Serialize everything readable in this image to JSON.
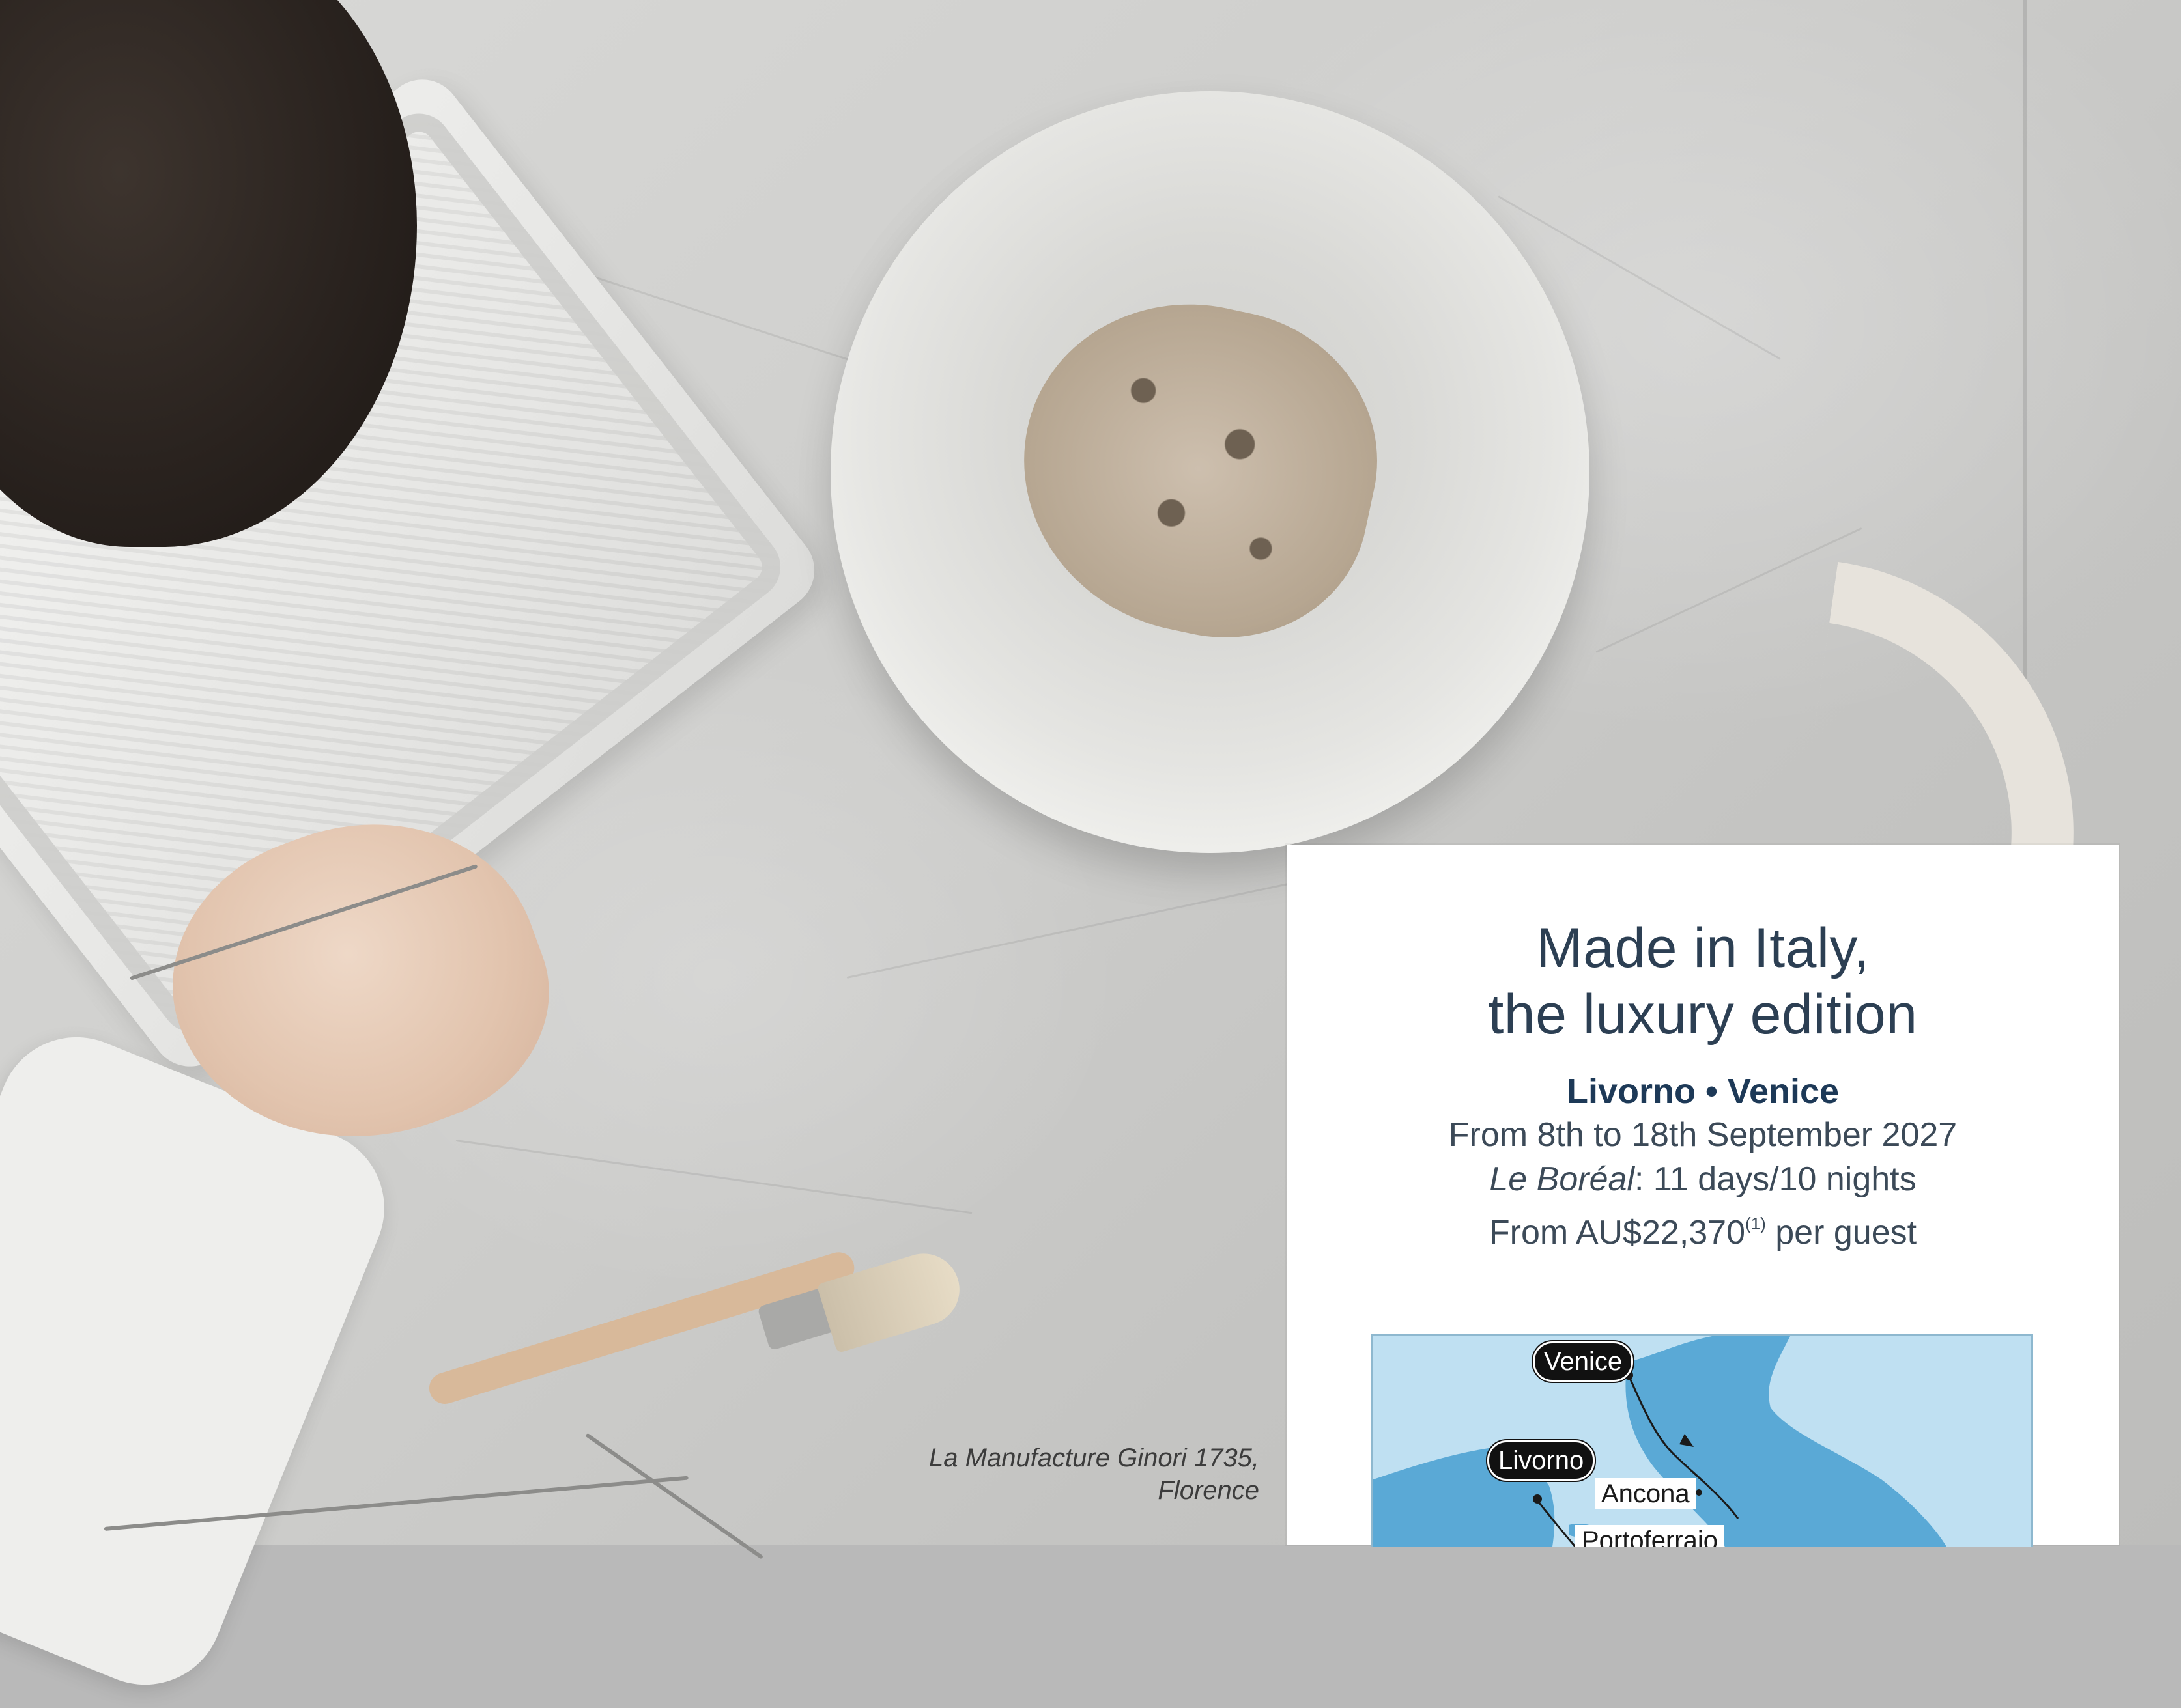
{
  "photo": {
    "caption_line1": "La Manufacture Ginori 1735,",
    "caption_line2": "Florence"
  },
  "card": {
    "title_line1": "Made in Italy,",
    "title_line2": "the luxury edition",
    "route_from": "Livorno",
    "route_separator": "•",
    "route_to": "Venice",
    "dates": "From 8th to 18th September 2027",
    "ship_name": "Le Boréal",
    "duration": ": 11 days/10 nights",
    "price_prefix": "From AU$22,370",
    "price_note": "(1)",
    "price_suffix": " per guest"
  },
  "map": {
    "labels": {
      "venice": "Venice",
      "livorno": "Livorno",
      "ancona": "Ancona",
      "portoferraio": "Portoferraio"
    },
    "colors": {
      "sea": "#bfe0f2",
      "land": "#5aa9d6",
      "route": "#1a1a1a"
    }
  }
}
